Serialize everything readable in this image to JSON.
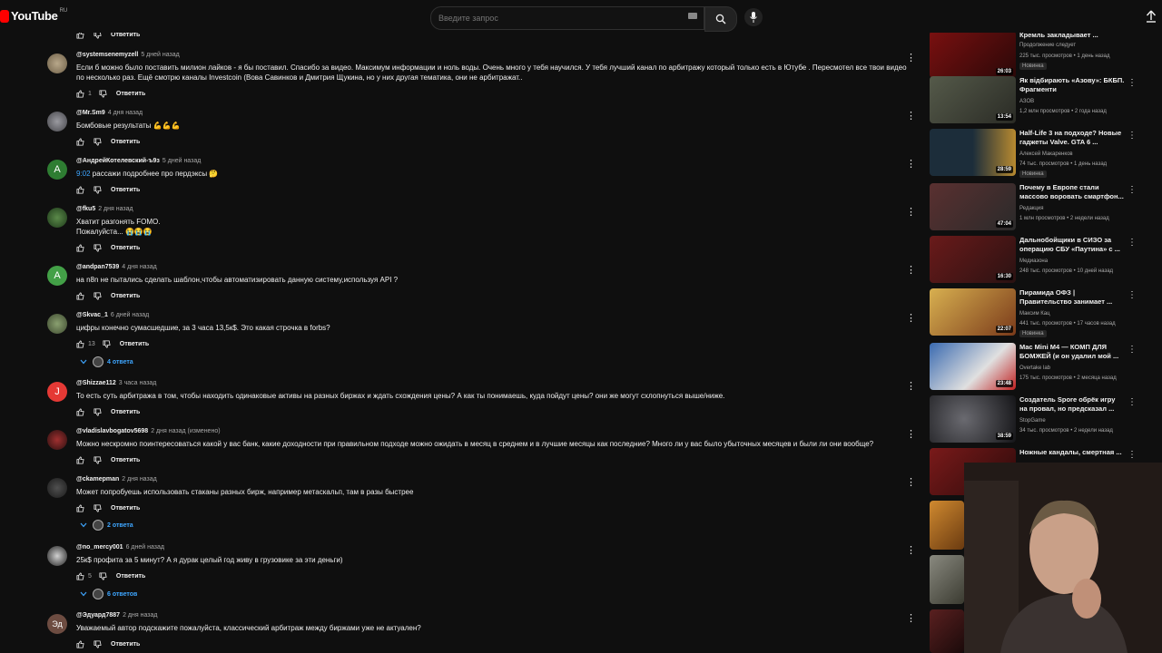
{
  "header": {
    "logo_text": "YouTube",
    "region": "RU",
    "search_placeholder": "Введите запрос"
  },
  "comments": [
    {
      "author": "",
      "time": "",
      "text": "",
      "likes": "",
      "reply_label": "Ответить",
      "replies_label": ""
    },
    {
      "author": "@systemsenemyzell",
      "time": "5 дней назад",
      "text": "Если б можно было поставить милион лайков - я бы поставил. Спасибо за видео. Максимум информации и ноль воды. Очень много у тебя научился. У тебя лучший канал по арбитражу который только есть в Ютубе . Пересмотел все твои видео по несколько раз. Ещё смотрю каналы Investcoin (Вова Савинков и Дмитрия Щукина, но у них другая тематика, они не арбитражат..",
      "likes": "1",
      "reply_label": "Ответить",
      "replies_label": ""
    },
    {
      "author": "@Mr.Sm9",
      "time": "4 дня назад",
      "text": "Бомбовые результаты 💪💪💪",
      "likes": "",
      "reply_label": "Ответить",
      "replies_label": ""
    },
    {
      "author": "@АндрейКотелевский-ъ9з",
      "time": "5 дней назад",
      "timestamp": "9:02",
      "text": " рассажи подробнее про пердэксы 🤔",
      "likes": "",
      "reply_label": "Ответить",
      "replies_label": ""
    },
    {
      "author": "@fku5",
      "time": "2 дня назад",
      "text": "Хватит разгонять FOMO.\nПожалуйста... 😭😭😭",
      "likes": "",
      "reply_label": "Ответить",
      "replies_label": ""
    },
    {
      "author": "@andpan7539",
      "time": "4 дня назад",
      "text": "на n8n не пытались сделать шаблон,чтобы автоматизировать данную систему,используя API ?",
      "likes": "",
      "reply_label": "Ответить",
      "replies_label": ""
    },
    {
      "author": "@Skvac_1",
      "time": "6 дней назад",
      "text": "цифры конечно сумасшедшие, за 3 часа 13,5к$. Это какая строчка в forbs?",
      "likes": "13",
      "reply_label": "Ответить",
      "replies_label": "4 ответа"
    },
    {
      "author": "@Shizzae112",
      "time": "3 часа назад",
      "text": "То есть суть арбитража в том, чтобы находить одинаковые активы на разных биржах и ждать схождения цены? А как ты понимаешь, куда пойдут цены? они же могут схлопнуться выше/ниже.",
      "likes": "",
      "reply_label": "Ответить",
      "replies_label": ""
    },
    {
      "author": "@vladislavbogatov5698",
      "time": "2 дня назад (изменено)",
      "text": "Можно нескромно поинтересоваться какой у вас банк, какие доходности при правильном подходе можно ожидать в месяц в среднем и в лучшие месяцы как последние? Много ли у вас было убыточных месяцев и были ли они вообще?",
      "likes": "",
      "reply_label": "Ответить",
      "replies_label": ""
    },
    {
      "author": "@ckamepman",
      "time": "2 дня назад",
      "text": "Может попробуешь использовать стаканы разных бирж, например метаскальп, там в разы быстрее",
      "likes": "",
      "reply_label": "Ответить",
      "replies_label": "2 ответа"
    },
    {
      "author": "@no_mercy001",
      "time": "6 дней назад",
      "text": "25к$ профита за 5 минут? А я дурак целый год живу в грузовике за эти деньги)",
      "likes": "5",
      "reply_label": "Ответить",
      "replies_label": "6 ответов"
    },
    {
      "author": "@Эдуард7887",
      "time": "2 дня назад",
      "text": "Уважаемый автор подскажите пожалуйста, классический арбитраж между биржами уже не актуален?",
      "likes": "",
      "reply_label": "Ответить",
      "replies_label": ""
    }
  ],
  "avatar_letters": {
    "andrey": "А",
    "andpan": "А",
    "shizzae": "J",
    "eduard": "Эд"
  },
  "recommendations": [
    {
      "title": "Кремль закладывает ...",
      "channel": "Продолжение следует",
      "meta": "225 тыс. просмотров • 1 день назад",
      "badge": "Новинка",
      "duration": "26:03",
      "color": "#7a1010"
    },
    {
      "title": "Як відбирають «Азову»: БКБП. Фрагменти",
      "channel": "АЗОВ",
      "meta": "1,2 млн просмотров • 2 года назад",
      "badge": "",
      "duration": "13:54",
      "color": "#3f4038"
    },
    {
      "title": "Half-Life 3 на подходе? Новые гаджеты Valve. GTA 6 ...",
      "channel": "Алексей Макаренков",
      "meta": "74 тыс. просмотров • 1 день назад",
      "badge": "Новинка",
      "duration": "28:59",
      "color": "#1c2d3a"
    },
    {
      "title": "Почему в Европе стали массово воровать смартфон...",
      "channel": "Редакция",
      "meta": "1 млн просмотров • 2 недели назад",
      "badge": "",
      "duration": "47:04",
      "color": "#3a2626"
    },
    {
      "title": "Дальнобойщики в СИЗО за операцию СБУ «Паутина» с ...",
      "channel": "Медиазона",
      "meta": "248 тыс. просмотров • 10 дней назад",
      "badge": "",
      "duration": "16:30",
      "color": "#4a1616"
    },
    {
      "title": "Пирамида ОФЗ | Правительство занимает ...",
      "channel": "Максим Кац",
      "meta": "441 тыс. просмотров • 17 часов назад",
      "badge": "Новинка",
      "duration": "22:07",
      "color": "#b8903a"
    },
    {
      "title": "Mac Mini M4 — КОМП ДЛЯ БОМЖЕЙ (и он удалил мой ...",
      "channel": "Overtake lab",
      "meta": "175 тыс. просмотров • 2 месяца назад",
      "badge": "",
      "duration": "23:48",
      "color": "#2a4d80"
    },
    {
      "title": "Создатель Spore обрёк игру на провал, но предсказал ...",
      "channel": "StopGame",
      "meta": "34 тыс. просмотров • 2 недели назад",
      "badge": "",
      "duration": "38:59",
      "color": "#1b1b1e"
    },
    {
      "title": "Ножные кандалы, смертная ...",
      "channel": "",
      "meta": "",
      "badge": "",
      "duration": "",
      "color": "#6a1313"
    }
  ],
  "colors": {
    "background": "#0f0f0f",
    "link_blue": "#3ea6ff",
    "brand_red": "#ff0000"
  }
}
